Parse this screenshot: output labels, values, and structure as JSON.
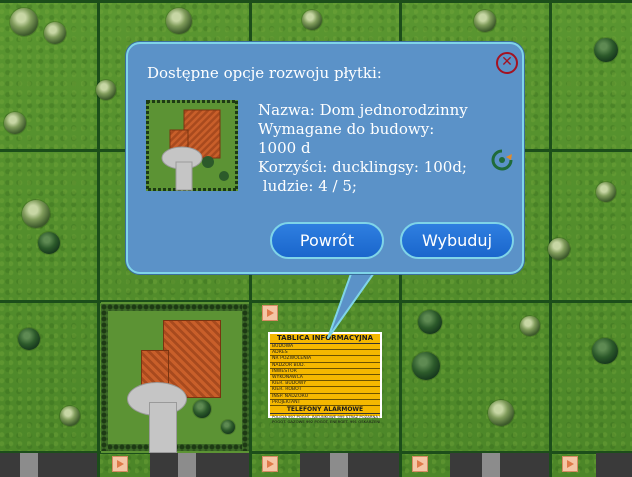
{
  "popup": {
    "title": "Dostępne opcje rozwoju płytki:",
    "close_icon": "close-icon",
    "refresh_icon": "rotate-icon",
    "details": {
      "name_line": "Nazwa: Dom jednorodzinny",
      "required_label": "Wymagane do budowy:",
      "required_value": "1000 d",
      "benefits_line": "Korzyści: ducklingsy: 100d;",
      "people_line": " ludzie: 4 / 5;"
    },
    "buttons": {
      "back_label": "Powrót",
      "build_label": "Wybuduj"
    }
  },
  "info_board": {
    "title": "TABLICA INFORMACYJNA",
    "rows": [
      "BUDOWA",
      "ADRES",
      "NR POZWOLENIA",
      "NADZÓR BUD.",
      "INWESTOR",
      "WYKONAWCA",
      "KIER. BUDOWY",
      "KIER. ROBÓT",
      "INSP. NADZORU",
      "PROJEKTANT"
    ],
    "phones_title": "TELEFONY ALARMOWE",
    "phones_rows": [
      "POLICJA       997  POGOT. RATUNKOWE  999  STRAŻ POŻARNA  998",
      "POGOT. GAZOWE  992  POGOT. ENERGET.  991  OSKARŻENIE PRACY"
    ]
  },
  "colors": {
    "popup_bg": "#5b92c8",
    "popup_border": "#7fd4e8",
    "button_bg": "#1a66cc",
    "close_red": "#a31222",
    "board_yellow": "#f5b800",
    "grass": "#4f8a2a"
  }
}
